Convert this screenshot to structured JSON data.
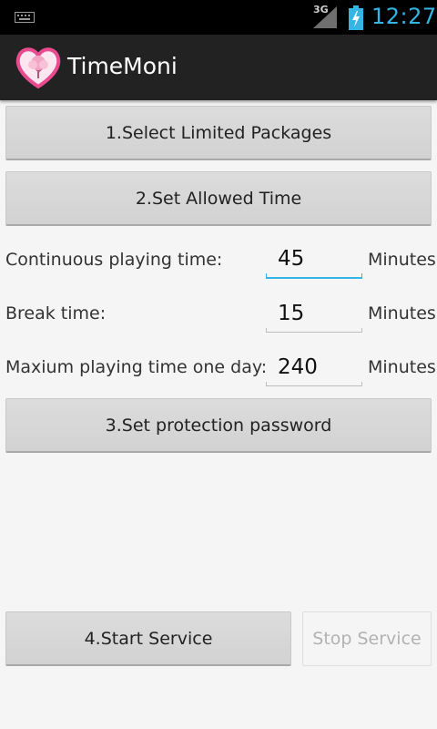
{
  "status_bar": {
    "network_type": "3G",
    "time": "12:27",
    "accent_color": "#33b5e5",
    "icons": [
      "keyboard-icon",
      "signal-icon",
      "battery-charging-icon"
    ]
  },
  "app": {
    "title": "TimeMoni",
    "icon": "heart-tree-icon",
    "brand_color": "#e94b8f"
  },
  "main": {
    "select_packages_label": "1.Select Limited Packages",
    "set_time_label": "2.Set Allowed Time",
    "settings": [
      {
        "label": "Continuous playing time:",
        "value": "45",
        "unit": "Minutes",
        "focused": true
      },
      {
        "label": "Break time:",
        "value": "15",
        "unit": "Minutes",
        "focused": false
      },
      {
        "label": "Maxium playing time one day:",
        "value": "240",
        "unit": "Minutes",
        "focused": false
      }
    ],
    "set_password_label": "3.Set protection password",
    "start_service_label": "4.Start Service",
    "stop_service_label": "Stop Service",
    "stop_service_enabled": false
  }
}
